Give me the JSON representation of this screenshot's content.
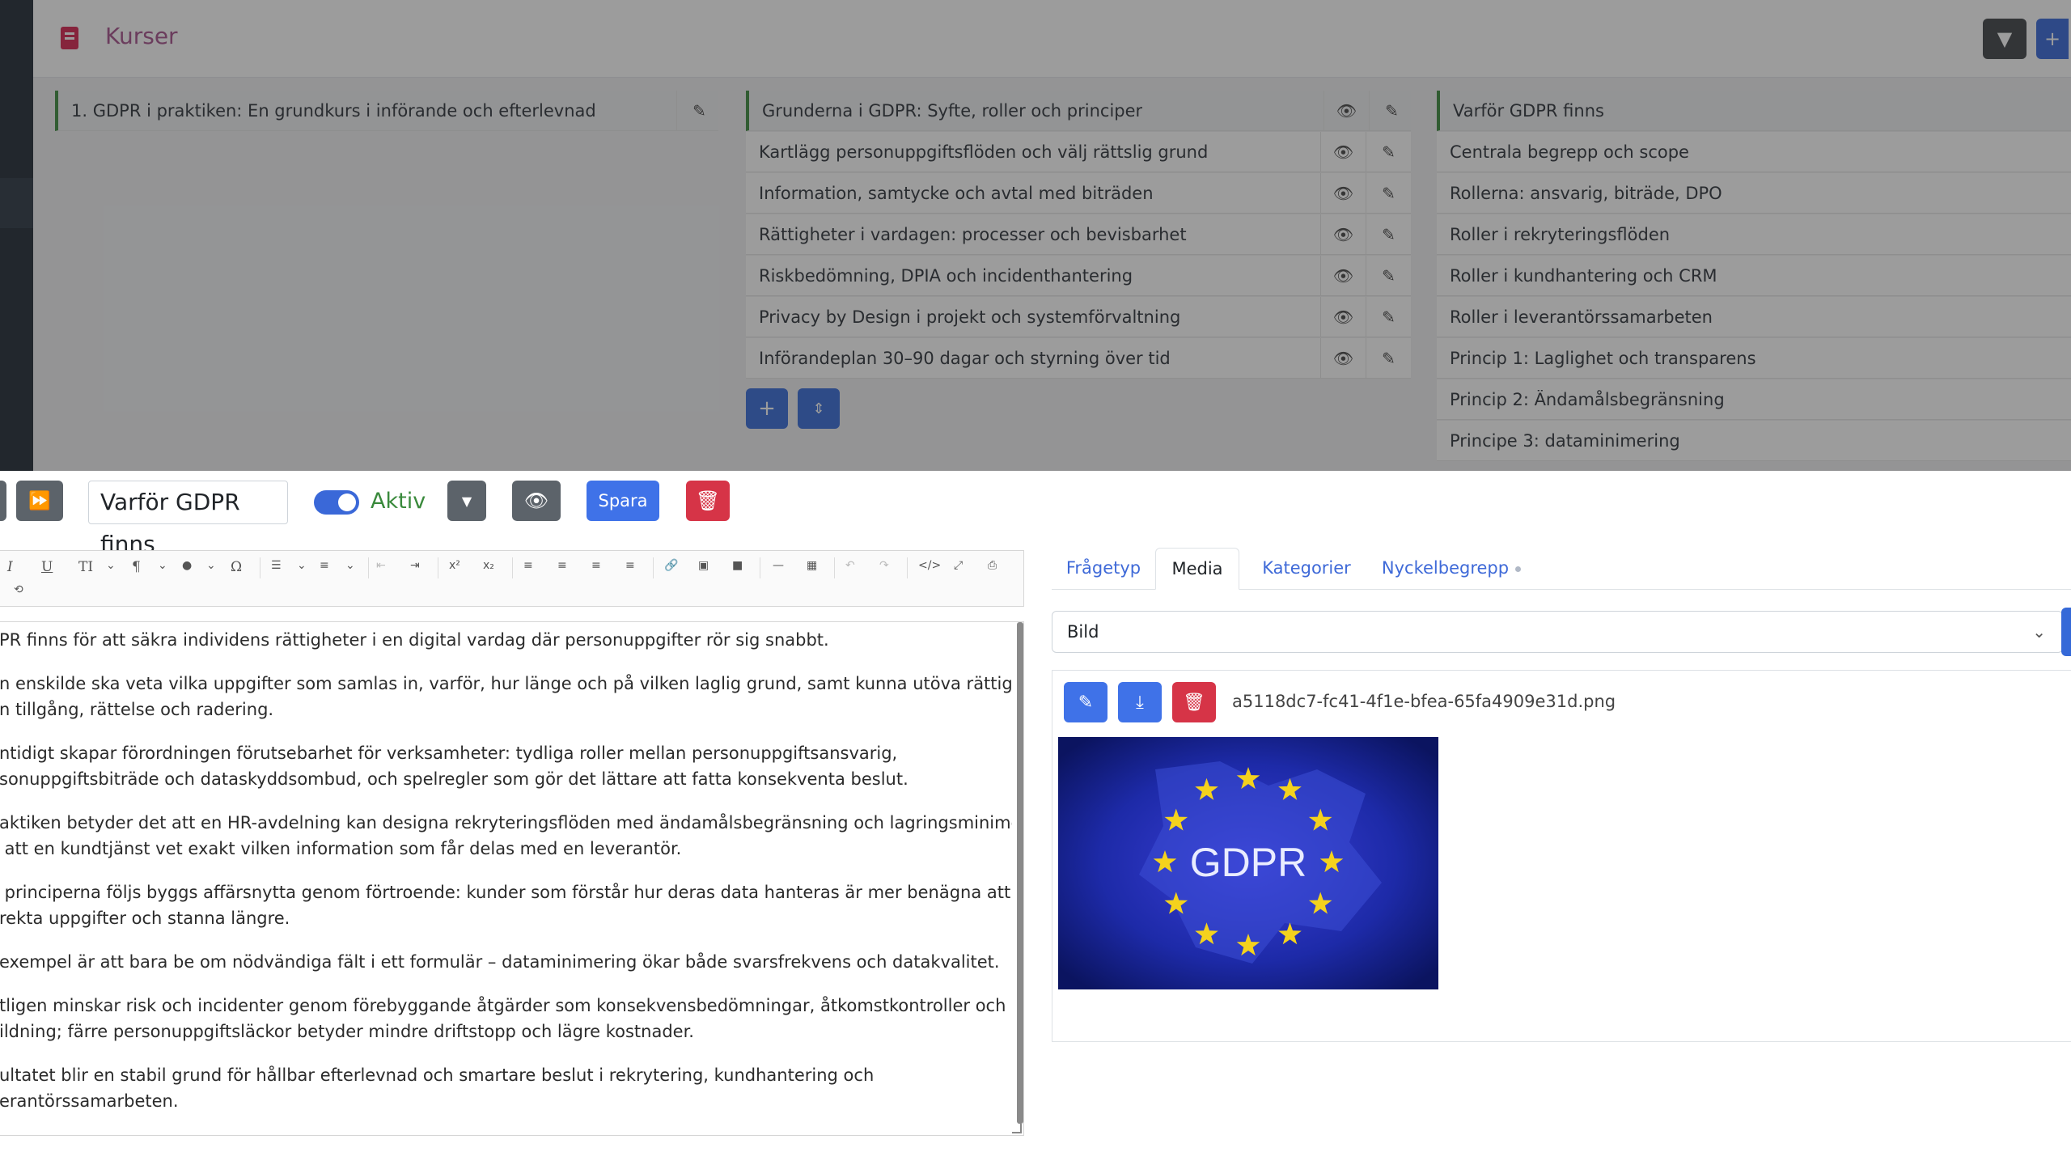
{
  "app": {
    "title": "Kurser",
    "filter_icon": "filter-icon",
    "add_icon": "plus-icon"
  },
  "courses": [
    {
      "label": "1. GDPR i praktiken: En grundkurs i införande och efterlevnad"
    }
  ],
  "modules": [
    {
      "label": "Grunderna i GDPR: Syfte, roller och principer"
    },
    {
      "label": "Kartlägg personuppgiftsflöden och välj rättslig grund"
    },
    {
      "label": "Information, samtycke och avtal med biträden"
    },
    {
      "label": "Rättigheter i vardagen: processer och bevisbarhet"
    },
    {
      "label": "Riskbedömning, DPIA och incidenthantering"
    },
    {
      "label": "Privacy by Design i projekt och systemförvaltning"
    },
    {
      "label": "Införandeplan 30–90 dagar och styrning över tid"
    }
  ],
  "lessons": [
    {
      "label": "Varför GDPR finns"
    },
    {
      "label": "Centrala begrepp och scope"
    },
    {
      "label": "Rollerna: ansvarig, biträde, DPO"
    },
    {
      "label": "Roller i rekryteringsflöden"
    },
    {
      "label": "Roller i kundhantering och CRM"
    },
    {
      "label": "Roller i leverantörssamarbeten"
    },
    {
      "label": "Princip 1: Laglighet och transparens"
    },
    {
      "label": "Princip 2: Ändamålsbegränsning"
    },
    {
      "label": "Principe 3: dataminimering"
    }
  ],
  "editor": {
    "title_value": "Varför GDPR finns",
    "active_label": "Aktiv",
    "save_label": "Spara",
    "paragraphs": [
      "PR finns för att säkra individens rättigheter i en digital vardag där personuppgifter rör sig snabbt.",
      "n enskilde ska veta vilka uppgifter som samlas in, varför, hur länge och på vilken laglig grund, samt kunna utöva rättigheter",
      "n tillgång, rättelse och radering.",
      "ntidigt skapar förordningen förutsebarhet för verksamheter: tydliga roller mellan personuppgiftsansvarig,",
      "sonuppgiftsbiträde och dataskyddsombud, och spelregler som gör det lättare att fatta konsekventa beslut.",
      "aktiken betyder det att en HR-avdelning kan designa rekryteringsflöden med ändamålsbegränsning och lagringsminimering,",
      " att en kundtjänst vet exakt vilken information som får delas med en leverantör.",
      " principerna följs byggs affärsnytta genom förtroende: kunder som förstår hur deras data hanteras är mer benägna att lämna",
      "rekta uppgifter och stanna längre.",
      "exempel är att bara be om nödvändiga fält i ett formulär – dataminimering ökar både svarsfrekvens och datakvalitet.",
      "tligen minskar risk och incidenter genom förebyggande åtgärder som konsekvensbedömningar, åtkomstkontroller och",
      "ildning; färre personuppgiftsläckor betyder mindre driftstopp och lägre kostnader.",
      "ultatet blir en stabil grund för hållbar efterlevnad och smartare beslut i rekrytering, kundhantering och",
      "erantörssamarbeten."
    ]
  },
  "tabs": [
    {
      "label": "Frågetyp"
    },
    {
      "label": "Media"
    },
    {
      "label": "Kategorier"
    },
    {
      "label": "Nyckelbegrepp"
    }
  ],
  "media": {
    "type_selected": "Bild",
    "filename": "a5118dc7-fc41-4f1e-bfea-65fa4909e31d.png",
    "image_text": "GDPR"
  },
  "colors": {
    "primary": "#3f72e8",
    "danger": "#d63447",
    "success": "#3a8a3c",
    "secondary": "#5c636a"
  }
}
